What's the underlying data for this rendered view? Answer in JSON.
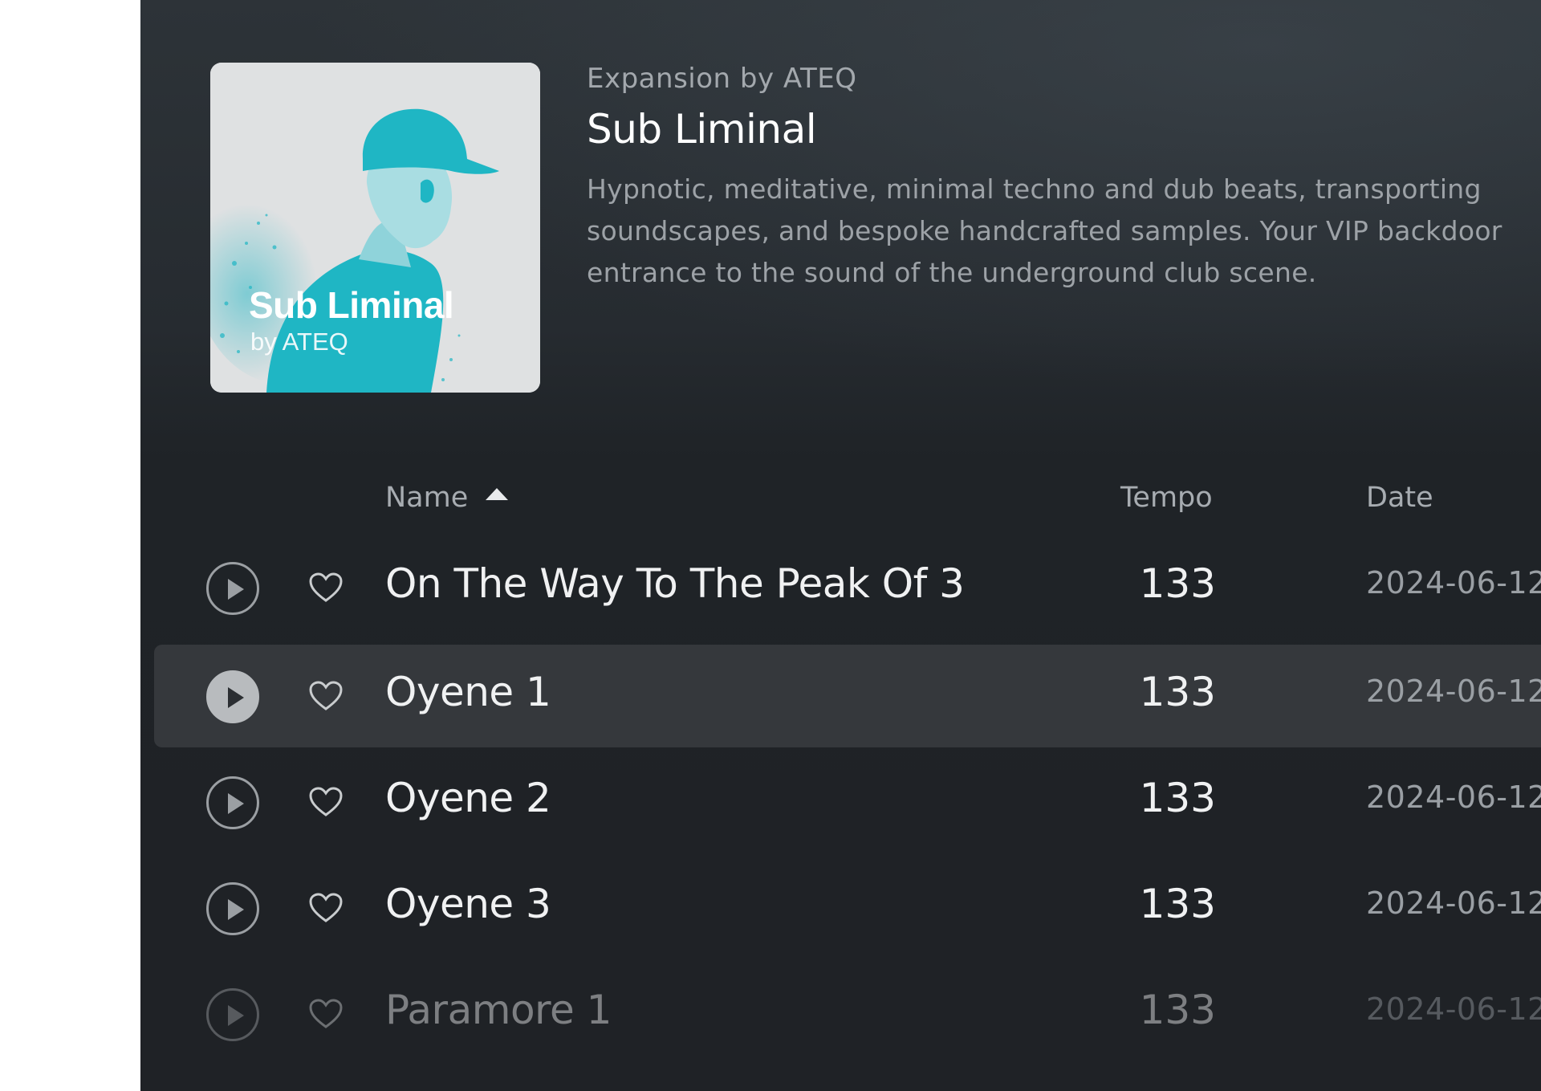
{
  "expansion": {
    "kicker": "Expansion by ATEQ",
    "title": "Sub Liminal",
    "description": "Hypnotic, meditative, minimal techno and dub beats, transporting soundscapes, and bespoke handcrafted samples. Your VIP backdoor entrance to the sound of the underground club scene.",
    "cover_title": "Sub Liminal",
    "cover_subtitle": "by ATEQ",
    "cover_accent": "#1fb6c4"
  },
  "table": {
    "headers": {
      "name": "Name",
      "tempo": "Tempo",
      "date": "Date"
    },
    "sort": {
      "column": "name",
      "direction": "ascending"
    },
    "rows": [
      {
        "name": "On The Way To The Peak Of 3",
        "tempo": "133",
        "date": "2024-06-12"
      },
      {
        "name": "Oyene 1",
        "tempo": "133",
        "date": "2024-06-12"
      },
      {
        "name": "Oyene 2",
        "tempo": "133",
        "date": "2024-06-12"
      },
      {
        "name": "Oyene 3",
        "tempo": "133",
        "date": "2024-06-12"
      },
      {
        "name": "Paramore 1",
        "tempo": "133",
        "date": "2024-06-12"
      }
    ]
  },
  "icons": {
    "play": "play-circle-icon",
    "favorite": "heart-outline-icon",
    "sort": "sort-ascending-icon"
  }
}
